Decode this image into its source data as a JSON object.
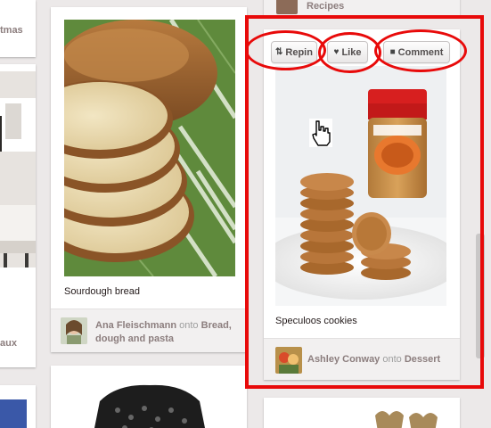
{
  "left_column": {
    "partial_label_top": "tmas",
    "partial_label_mid": "aux"
  },
  "top_strip": {
    "board_label": "Recipes"
  },
  "pin_bread": {
    "caption": "Sourdough bread",
    "pinner": "Ana Fleischmann",
    "onto_word": "onto",
    "board": "Bread, dough and pasta",
    "board_line1": "Bread,",
    "board_line2": "dough and pasta"
  },
  "pin_cookies": {
    "actions": {
      "repin": "Repin",
      "like": "Like",
      "comment": "Comment"
    },
    "caption": "Speculoos cookies",
    "pinner": "Ashley Conway",
    "onto_word": "onto",
    "board": "Dessert"
  },
  "colors": {
    "highlight": "#e80a0a",
    "background": "#ece9e9",
    "card": "#ffffff",
    "attribution_bg": "#f2f0f0"
  },
  "icons": [
    "repin-icon",
    "heart-icon",
    "comment-icon",
    "hand-cursor-icon"
  ]
}
